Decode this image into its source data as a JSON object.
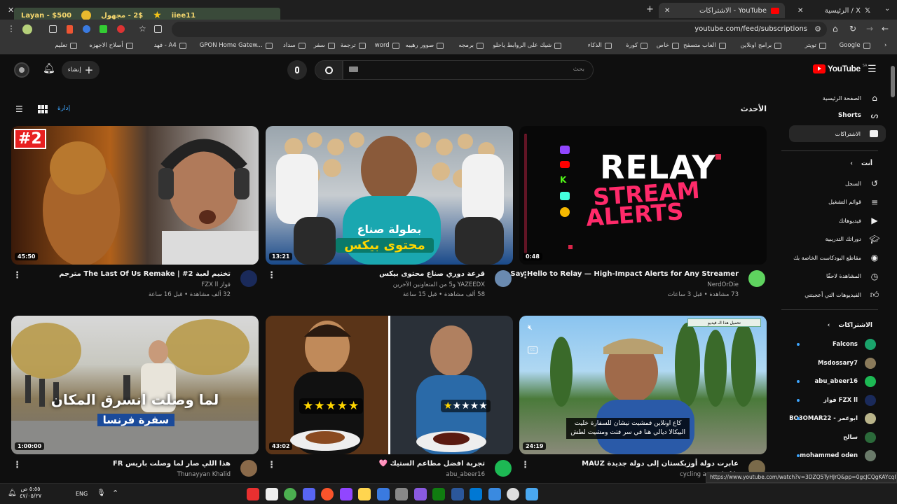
{
  "browser": {
    "tabs": [
      {
        "label": "X / الرئيسية"
      },
      {
        "label": "YouTube - الاشتراكات"
      }
    ],
    "url": "youtube.com/feed/subscriptions",
    "game_overlay": {
      "player": "Layan - $500",
      "coins": "2$ - مجهول",
      "user": "iiee11"
    },
    "bookmarks": [
      "Google",
      "تويتر",
      "برامج اونلاين",
      "العاب متصفح",
      "خاص",
      "كورة",
      "الذكاء",
      "شيك على الروابط ياحلو",
      "برمجه",
      "صوور رهيبه",
      "word",
      "ترجمة",
      "سفر",
      "سداد",
      "GPON Home Gatew...",
      "فهد - A4",
      "أصلاح الاجهزه",
      "تعليم"
    ]
  },
  "header": {
    "logo": "YouTube",
    "region": "SA",
    "search_placeholder": "بحث",
    "create_label": "إنشاء"
  },
  "sidebar": {
    "main": [
      {
        "label": "الصفحة الرئيسية",
        "icon": "home-icon"
      },
      {
        "label": "Shorts",
        "icon": "shorts-icon"
      },
      {
        "label": "الاشتراكات",
        "icon": "subscriptions-icon"
      }
    ],
    "you_header": "أنت",
    "you": [
      {
        "label": "السجل",
        "icon": "history-icon"
      },
      {
        "label": "قوائم التشغيل",
        "icon": "playlist-icon"
      },
      {
        "label": "فيديوهاتك",
        "icon": "your-videos-icon"
      },
      {
        "label": "دوراتك التدريبية",
        "icon": "courses-icon"
      },
      {
        "label": "مقاطع البودكاست الخاصة بك",
        "icon": "podcast-icon"
      },
      {
        "label": "المشاهدة لاحقًا",
        "icon": "watch-later-icon"
      },
      {
        "label": "الفيديوهات التي أعجبتني",
        "icon": "like-icon"
      }
    ],
    "subs_header": "الاشتراكات",
    "subs": [
      {
        "label": "Falcons",
        "color": "#1aa36b",
        "dot": true
      },
      {
        "label": "Msdossary7",
        "color": "#8a7a5a",
        "dot": false
      },
      {
        "label": "abu_abeer16",
        "color": "#1db954",
        "dot": true
      },
      {
        "label": "فواز FZX ll",
        "color": "#1a2a5a",
        "dot": true
      },
      {
        "label": "BO3OMAR22 - ابوعمر",
        "color": "#b9b48a",
        "dot": true
      },
      {
        "label": "سالح",
        "color": "#2b6a3a",
        "dot": false
      },
      {
        "label": "mohammed oden",
        "color": "#6a7a6a",
        "dot": true
      }
    ]
  },
  "feed": {
    "section_title": "الأحدث",
    "manage_label": "إدارة",
    "videos": [
      {
        "title": "Say Hello to Relay — High-Impact Alerts for Any Streamer",
        "channel": "NerdOrDie",
        "meta": "73 مشاهدة • قبل 3 ساعات",
        "duration": "0:48",
        "avatar": "#5fd35f"
      },
      {
        "title": "قرعة دوري صناع محتوى بيكس",
        "channel": "YAZEEDX و5 من المتعاونين الآخرين",
        "meta": "58 ألف مشاهدة • قبل 15 ساعة",
        "duration": "13:21",
        "avatar": "#6a8ab0"
      },
      {
        "title": "تختيم لعبة The Last Of Us Remake | #2 مترجم",
        "channel": "فواز FZX ll",
        "meta": "32 ألف مشاهدة • قبل 16 ساعة",
        "duration": "45:50",
        "avatar": "#1a2a5a"
      },
      {
        "title": "عابرت دولة أوزبكستان إلى دولة جديدة MAUZ",
        "channel": "cycling around afric",
        "meta": "",
        "duration": "24:19",
        "avatar": "#7a6a4a"
      },
      {
        "title": "تجربة افضل مطاعم الستيك 🩷",
        "channel": "abu_abeer16",
        "meta": "",
        "duration": "43:02",
        "avatar": "#1db954"
      },
      {
        "title": "هذا اللي صار لما وصلت باريس FR",
        "channel": "Thunayyan Khalid",
        "meta": "",
        "duration": "1:00:00",
        "avatar": "#8a6a4a"
      }
    ],
    "thumb_texts": {
      "relay1": "RELAY",
      "relay2": "STREAM",
      "relay3": "ALERTS",
      "bix1": "بطولة صناع",
      "bix2": "محتوى بيكس",
      "tlou": "#2",
      "mauz_line1": "كاع اونلاين فمشيت نيشان للسفارة خليت",
      "mauz_line2": "البيكالا ديالي هنا في سر فتت ومشيت لطش",
      "mauz_popup": "تحميل هذا الـ فيديو",
      "paris1": "لما وصلت انسرق المكان",
      "paris2": "سفرة فرنسا"
    }
  },
  "status_url": "https://www.youtube.com/watch?v=3DZQ5TyHJrQ&pp=0gcJCQgKAYcqIYzv",
  "taskbar": {
    "lang": "ENG",
    "time": "٥:٥٥ ص",
    "date": "٤٧/٠٥/٢٧"
  }
}
